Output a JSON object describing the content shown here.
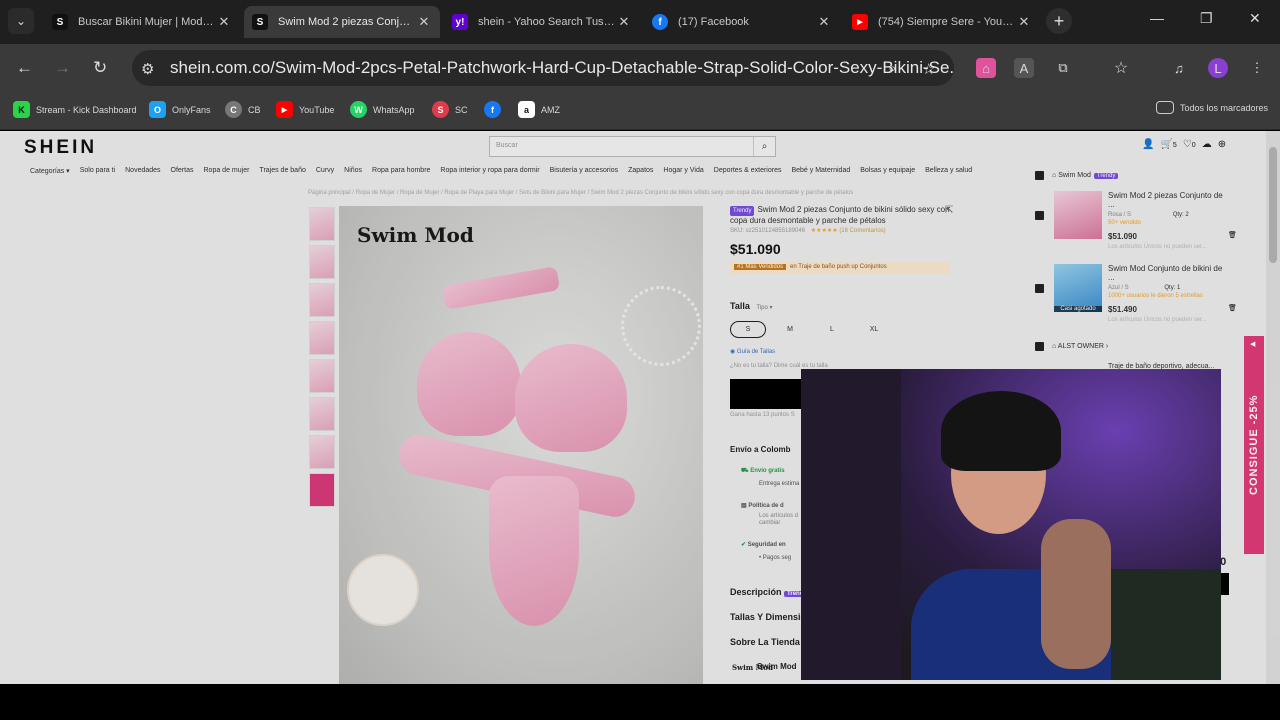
{
  "tabs": [
    {
      "title": "Buscar Bikini Mujer | Moda Bikini",
      "favicon": "S",
      "active": false
    },
    {
      "title": "Swim Mod 2 piezas Conjunto de",
      "favicon": "S",
      "active": true
    },
    {
      "title": "shein - Yahoo Search Tus resulta",
      "favicon": "y!",
      "active": false
    },
    {
      "title": "(17) Facebook",
      "favicon": "f",
      "active": false
    },
    {
      "title": "(754) Siempre Sere - YouTube",
      "favicon": "▶",
      "active": false
    }
  ],
  "toolbar": {
    "url": "shein.com.co/Swim-Mod-2pcs-Petal-Patchwork-Hard-Cup-Detachable-Strap-Solid-Color-Sexy-Bikini-Se...",
    "profile_initial": "L"
  },
  "bookmarks": [
    {
      "label": "Stream - Kick Dashboard",
      "icon": "K",
      "color": "#2bd34c"
    },
    {
      "label": "OnlyFans",
      "icon": "O",
      "color": "#1da1f2"
    },
    {
      "label": "CB",
      "icon": "C",
      "color": "#888888"
    },
    {
      "label": "YouTube",
      "icon": "▶",
      "color": "#ff0000"
    },
    {
      "label": "WhatsApp",
      "icon": "W",
      "color": "#25d366"
    },
    {
      "label": "SC",
      "icon": "S",
      "color": "#e03b4c"
    },
    {
      "label": "",
      "icon": "f",
      "color": "#1877f2"
    },
    {
      "label": "AMZ",
      "icon": "a",
      "color": "#111111"
    }
  ],
  "all_bookmarks": "Todos los marcadores",
  "shein": {
    "logo": "SHEIN",
    "search_placeholder": "Buscar",
    "cart_count": "5",
    "wish_count": "0",
    "categories": [
      "Categorías ▾",
      "Solo para ti",
      "Novedades",
      "Ofertas",
      "Ropa de mujer",
      "Trajes de baño",
      "Curvy",
      "Niños",
      "Ropa para hombre",
      "Ropa interior y ropa para dormir",
      "Bisutería y accesorios",
      "Zapatos",
      "Hogar y Vida",
      "Deportes & exteriores",
      "Bebé y Maternidad",
      "Bolsas y equipaje",
      "Belleza y salud"
    ],
    "breadcrumb": "Página principal / Ropa de Mujer / Ropa de Mujer / Ropa de Playa para Mujer / Sets de Bikini para Mujer / Swim Mod 2 piezas Conjunto de bikini sólido sexy con copa dura desmontable y parche de pétalos",
    "image_brand": "Swim Mod",
    "product": {
      "badge": "Trendy",
      "title": "Swim Mod 2 piezas Conjunto de bikini sólido sexy con copa dura desmontable y parche de pétalos",
      "sku": "SKU: sz2510124855189046",
      "rating_text": "(16 Comentarios)",
      "price": "$51.090",
      "best_seller": "#1 Más Vendidos",
      "best_seller_cat": "en Traje de baño push up Conjuntos",
      "size_label": "Talla",
      "size_type": "Tipo ▾",
      "sizes": [
        "S",
        "M",
        "L",
        "XL"
      ],
      "size_guide": "Guía de Tallas",
      "size_question": "¿No es tu talla? Dime cuál es tu talla",
      "points": "Gana hasta 13 puntos S",
      "shipping_to": "Envío a Colomb",
      "free_shipping": "Envío gratis",
      "delivery": "Entrega estima",
      "policy": "Política de d",
      "policy_text": "Los artículos d",
      "policy_text2": "cambiar",
      "security": "Seguridad en",
      "secure_pay": "• Pagos seg",
      "desc_label": "Descripción",
      "sizes_label": "Tallas Y Dimensio",
      "store_label": "Sobre La Tienda",
      "store_name": "Swim Mod"
    },
    "side": {
      "store1": "Swim Mod",
      "store1_badge": "Trendy",
      "item1_title": "Swim Mod 2 piezas Conjunto de ...",
      "item1_variant": "Rosa / S",
      "item1_qty": "Qty: 2",
      "item1_sold": "50+ vendido",
      "item1_price": "$51.090",
      "item1_note": "Los artículos Únicos no pueden ser...",
      "item2_title": "Swim Mod Conjunto de bikini de ...",
      "item2_variant": "Azul / S",
      "item2_qty": "Qty: 1",
      "item2_sold": "1000+ usuarios le dieron 5 estrellas",
      "item2_price": "$51.490",
      "item2_note": "Los artículos Únicos no pueden ser...",
      "item2_tag": "Casi agotado",
      "store2": "ALST OWNER",
      "item3_title": "Traje de baño deportivo, adecua...",
      "total_frag": "50"
    },
    "promo": "CONSIGUE -25%"
  }
}
